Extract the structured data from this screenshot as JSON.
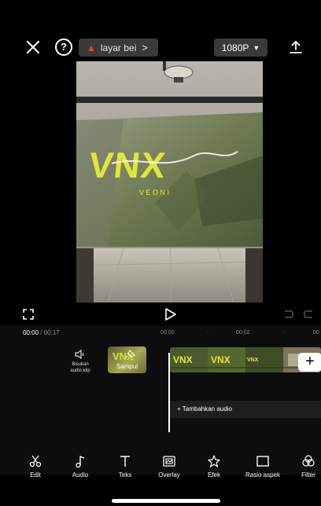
{
  "header": {
    "close_icon": "close-icon",
    "help_label": "?",
    "trend_label": "layar beі",
    "trend_chevron": ">",
    "resolution": "1080P",
    "export_icon": "upload-icon"
  },
  "preview": {
    "logo_text": "VNX",
    "logo_subtext": "V E O N I"
  },
  "playback": {
    "current_time": "00:00",
    "separator": " / ",
    "total_time": "00:17",
    "ruler_marks": [
      "00:00",
      "·",
      "00:02",
      "·",
      "00"
    ]
  },
  "timeline": {
    "mute_label_line1": "Bisukan",
    "mute_label_line2": "audio klip",
    "cover_label": "Sampul",
    "add_audio_label": "+ Tambahkan audio",
    "add_clip": "+"
  },
  "toolbar": {
    "items": [
      {
        "label": "Edit",
        "icon": "scissors-icon"
      },
      {
        "label": "Audio",
        "icon": "music-note-icon"
      },
      {
        "label": "Teks",
        "icon": "text-icon"
      },
      {
        "label": "Overlay",
        "icon": "overlay-icon"
      },
      {
        "label": "Efek",
        "icon": "star-effects-icon"
      },
      {
        "label": "Rasio aspek",
        "icon": "aspect-ratio-icon"
      },
      {
        "label": "Filter",
        "icon": "filter-icon"
      }
    ]
  },
  "colors": {
    "background": "#000000",
    "panel": "#0d0d0d",
    "chip": "#3a3a3a",
    "trend_fire": "#ff3b2f",
    "logo_yellow": "#e2e63a"
  }
}
